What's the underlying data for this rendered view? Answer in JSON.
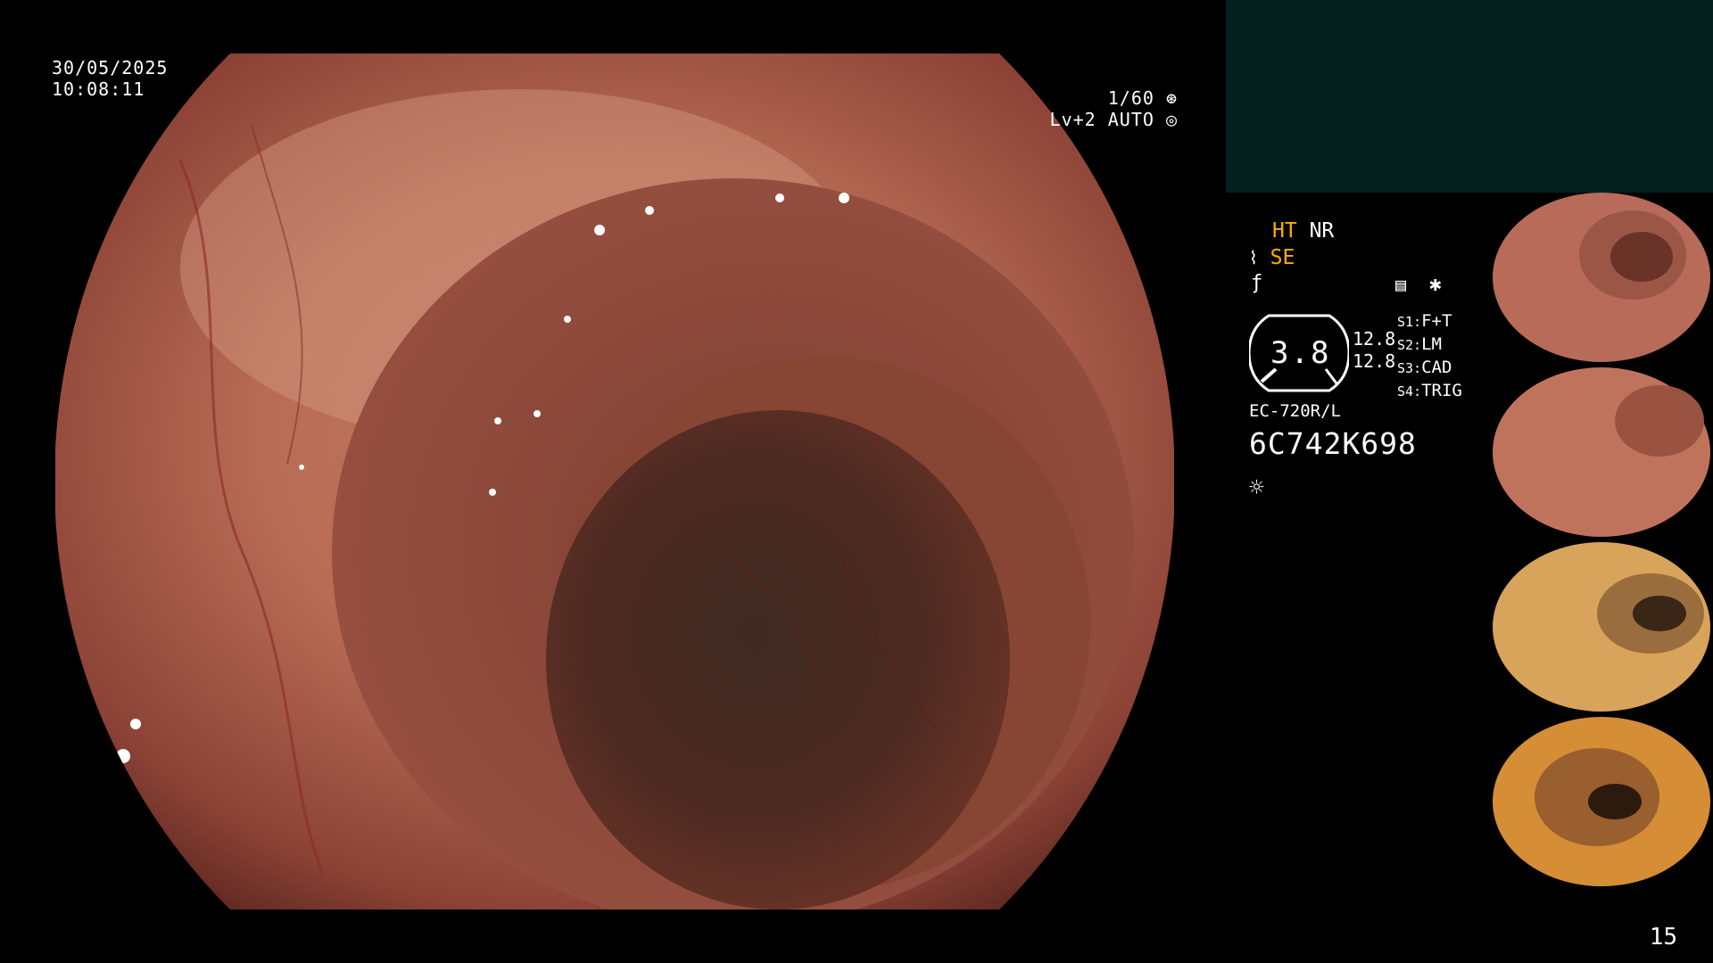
{
  "overlay": {
    "date": "30/05/2025",
    "time": "10:08:11",
    "shutter": "1/60",
    "level": "Lv+2 AUTO"
  },
  "status": {
    "ht": "HT",
    "nr": "NR",
    "se": "SE",
    "gauge_value": "3.8",
    "val1": "12.8",
    "val2": "12.8",
    "s1_label": "S1:",
    "s1_value": "F+T",
    "s2_label": "S2:",
    "s2_value": "LM",
    "s3_label": "S3:",
    "s3_value": "CAD",
    "s4_label": "S4:",
    "s4_value": "TRIG",
    "model": "EC-720R/L",
    "serial": "6C742K698"
  },
  "page_number": "15",
  "colors": {
    "accent_orange": "#ffae00",
    "panel_teal": "#03201e"
  },
  "icons": [
    "shutter-icon",
    "auto-iris-icon",
    "scope-icon",
    "enhance-icon",
    "memo-icon",
    "asterisk-icon",
    "light-icon"
  ]
}
